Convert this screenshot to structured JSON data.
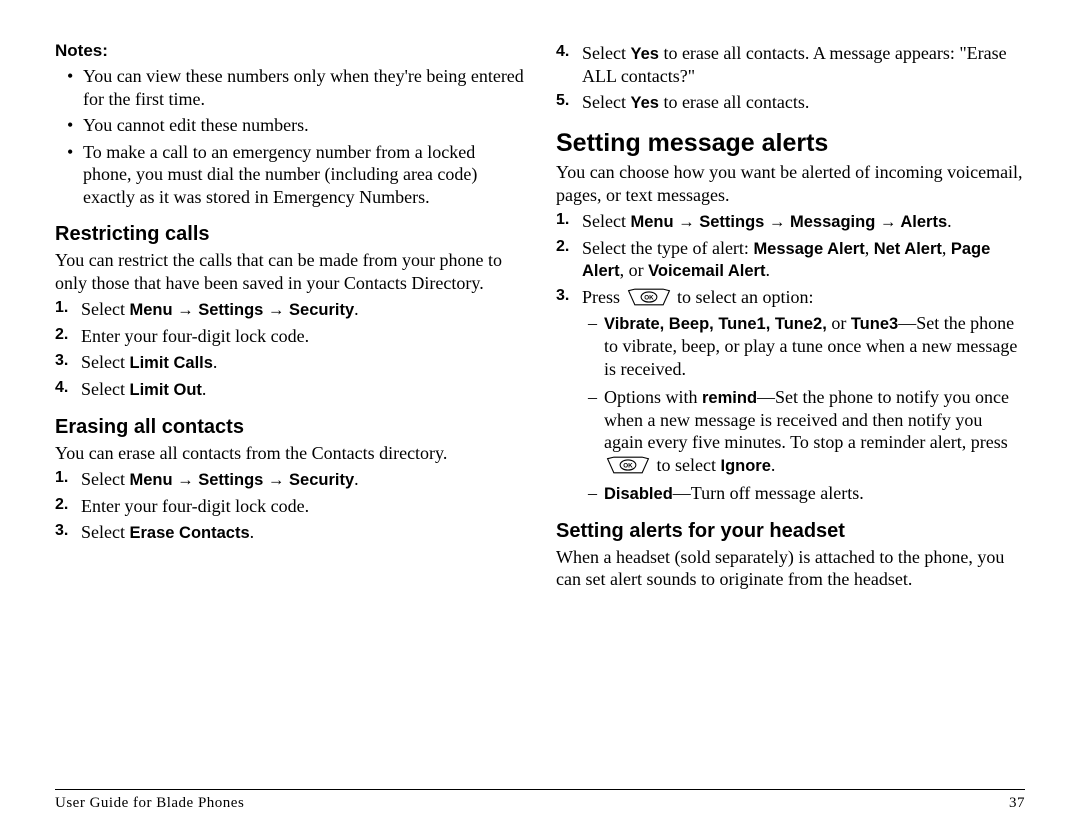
{
  "left": {
    "notes_label": "Notes:",
    "notes": [
      "You can view these numbers only when they're being entered for the first time.",
      "You cannot edit these numbers.",
      "To make a call to an emergency number from a locked phone, you must dial the number (including area code) exactly as it was stored in Emergency Numbers."
    ],
    "restrict_hd": "Restricting calls",
    "restrict_p": "You can restrict the calls that can be made from your phone to only those that have been saved in your Contacts Directory.",
    "restrict_step1_a": "Select ",
    "restrict_step1_b": "Menu",
    "restrict_step1_c": "Settings",
    "restrict_step1_d": "Security",
    "restrict_step2": "Enter your four-digit lock code.",
    "restrict_step3_a": "Select ",
    "restrict_step3_b": "Limit Calls",
    "restrict_step4_a": "Select ",
    "restrict_step4_b": "Limit Out",
    "erase_hd": "Erasing all contacts",
    "erase_p": "You can erase all contacts from the Contacts directory.",
    "erase_step1_a": "Select ",
    "erase_step1_b": "Menu",
    "erase_step1_c": "Settings",
    "erase_step1_d": "Security",
    "erase_step2": "Enter your four-digit lock code.",
    "erase_step3_a": "Select ",
    "erase_step3_b": "Erase Contacts"
  },
  "right": {
    "cont_step4_a": "Select ",
    "cont_step4_b": "Yes",
    "cont_step4_c": " to erase all contacts. A message appears: \"Erase ALL contacts?\"",
    "cont_step5_a": "Select ",
    "cont_step5_b": "Yes",
    "cont_step5_c": " to erase all contacts.",
    "alerts_hd": "Setting message alerts",
    "alerts_p": "You can choose how you want be alerted of incoming voicemail, pages, or text messages.",
    "al_step1_a": "Select ",
    "al_step1_b": "Menu",
    "al_step1_c": "Settings",
    "al_step1_d": "Messaging",
    "al_step1_e": "Alerts",
    "al_step2_a": "Select the type of alert: ",
    "al_step2_b": "Message Alert",
    "al_step2_c": "Net Alert",
    "al_step2_d": "Page Alert",
    "al_step2_e": ", or ",
    "al_step2_f": "Voicemail Alert",
    "al_step3_a": "Press ",
    "al_step3_b": " to select an option:",
    "opt1_a": "Vibrate, Beep, Tune1, Tune2,",
    "opt1_b": " or ",
    "opt1_c": "Tune3",
    "opt1_d": "—Set the phone to vibrate, beep, or play a tune once when a new message is received.",
    "opt2_a": "Options with ",
    "opt2_b": "remind",
    "opt2_c": "—Set the phone to notify you once when a new message is received and then notify you again every five minutes. To stop a reminder alert, press ",
    "opt2_d": " to select ",
    "opt2_e": "Ignore",
    "opt3_a": "Disabled",
    "opt3_b": "—Turn off message alerts.",
    "headset_hd": "Setting alerts for your headset",
    "headset_p": "When a headset (sold separately) is attached to the phone, you can set alert sounds to originate from the headset."
  },
  "footer": {
    "left": "User Guide for Blade Phones",
    "right": "37"
  },
  "arrow": " → "
}
